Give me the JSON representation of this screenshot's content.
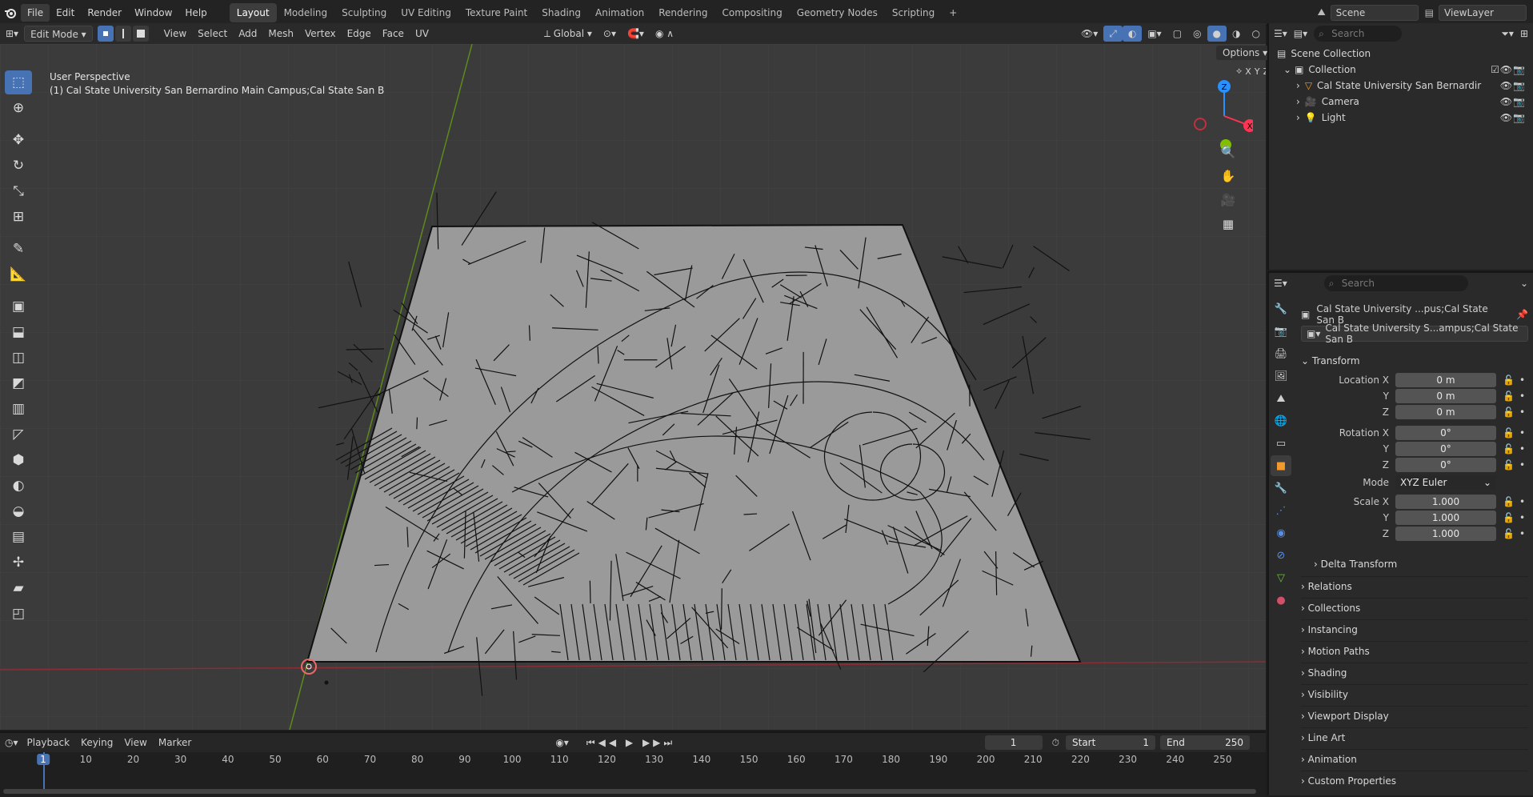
{
  "app": {
    "logo_icon": "blender-logo-icon"
  },
  "menus": [
    "File",
    "Edit",
    "Render",
    "Window",
    "Help"
  ],
  "workspaces": [
    "Layout",
    "Modeling",
    "Sculpting",
    "UV Editing",
    "Texture Paint",
    "Shading",
    "Animation",
    "Rendering",
    "Compositing",
    "Geometry Nodes",
    "Scripting"
  ],
  "scene": {
    "name": "Scene",
    "view_layer": "ViewLayer"
  },
  "viewport_header": {
    "mode": "Edit Mode",
    "menus": [
      "View",
      "Select",
      "Add",
      "Mesh",
      "Vertex",
      "Edge",
      "Face",
      "UV"
    ],
    "transform_orientation": "Global"
  },
  "viewport": {
    "title": "User Perspective",
    "subtitle": "(1) Cal State University San Bernardino Main Campus;Cal State San B",
    "options_label": "Options",
    "axis_labels": {
      "x": "X",
      "y": "Y",
      "z": "Z"
    }
  },
  "outliner": {
    "search_placeholder": "Search",
    "root": "Scene Collection",
    "collection": "Collection",
    "items": [
      {
        "name": "Cal State University San Bernardir",
        "icon": "mesh-object-icon"
      },
      {
        "name": "Camera",
        "icon": "camera-icon"
      },
      {
        "name": "Light",
        "icon": "light-icon"
      }
    ]
  },
  "properties": {
    "search_placeholder": "Search",
    "object_name": "Cal State University ...pus;Cal State San B",
    "data_name": "Cal State University S...ampus;Cal State San B",
    "transform_title": "Transform",
    "location": {
      "label": "Location X",
      "x": "0 m",
      "y": "0 m",
      "z": "0 m"
    },
    "rotation": {
      "label": "Rotation X",
      "x": "0°",
      "y": "0°",
      "z": "0°"
    },
    "mode": {
      "label": "Mode",
      "value": "XYZ Euler"
    },
    "scale": {
      "label": "Scale X",
      "x": "1.000",
      "y": "1.000",
      "z": "1.000"
    },
    "axis_y": "Y",
    "axis_z": "Z",
    "delta": "Delta Transform",
    "panels": [
      "Relations",
      "Collections",
      "Instancing",
      "Motion Paths",
      "Shading",
      "Visibility",
      "Viewport Display",
      "Line Art",
      "Animation",
      "Custom Properties"
    ]
  },
  "timeline": {
    "menus": [
      "Playback",
      "Keying",
      "View",
      "Marker"
    ],
    "current_frame": "1",
    "start_label": "Start",
    "start": "1",
    "end_label": "End",
    "end": "250",
    "ticks": [
      "1",
      "10",
      "20",
      "30",
      "40",
      "50",
      "60",
      "70",
      "80",
      "90",
      "100",
      "110",
      "120",
      "130",
      "140",
      "150",
      "160",
      "170",
      "180",
      "190",
      "200",
      "210",
      "220",
      "230",
      "240",
      "250"
    ]
  },
  "colors": {
    "accent": "#4772b3",
    "x_axis": "#ff3352",
    "y_axis": "#8bdc00",
    "z_axis": "#2890ff"
  }
}
